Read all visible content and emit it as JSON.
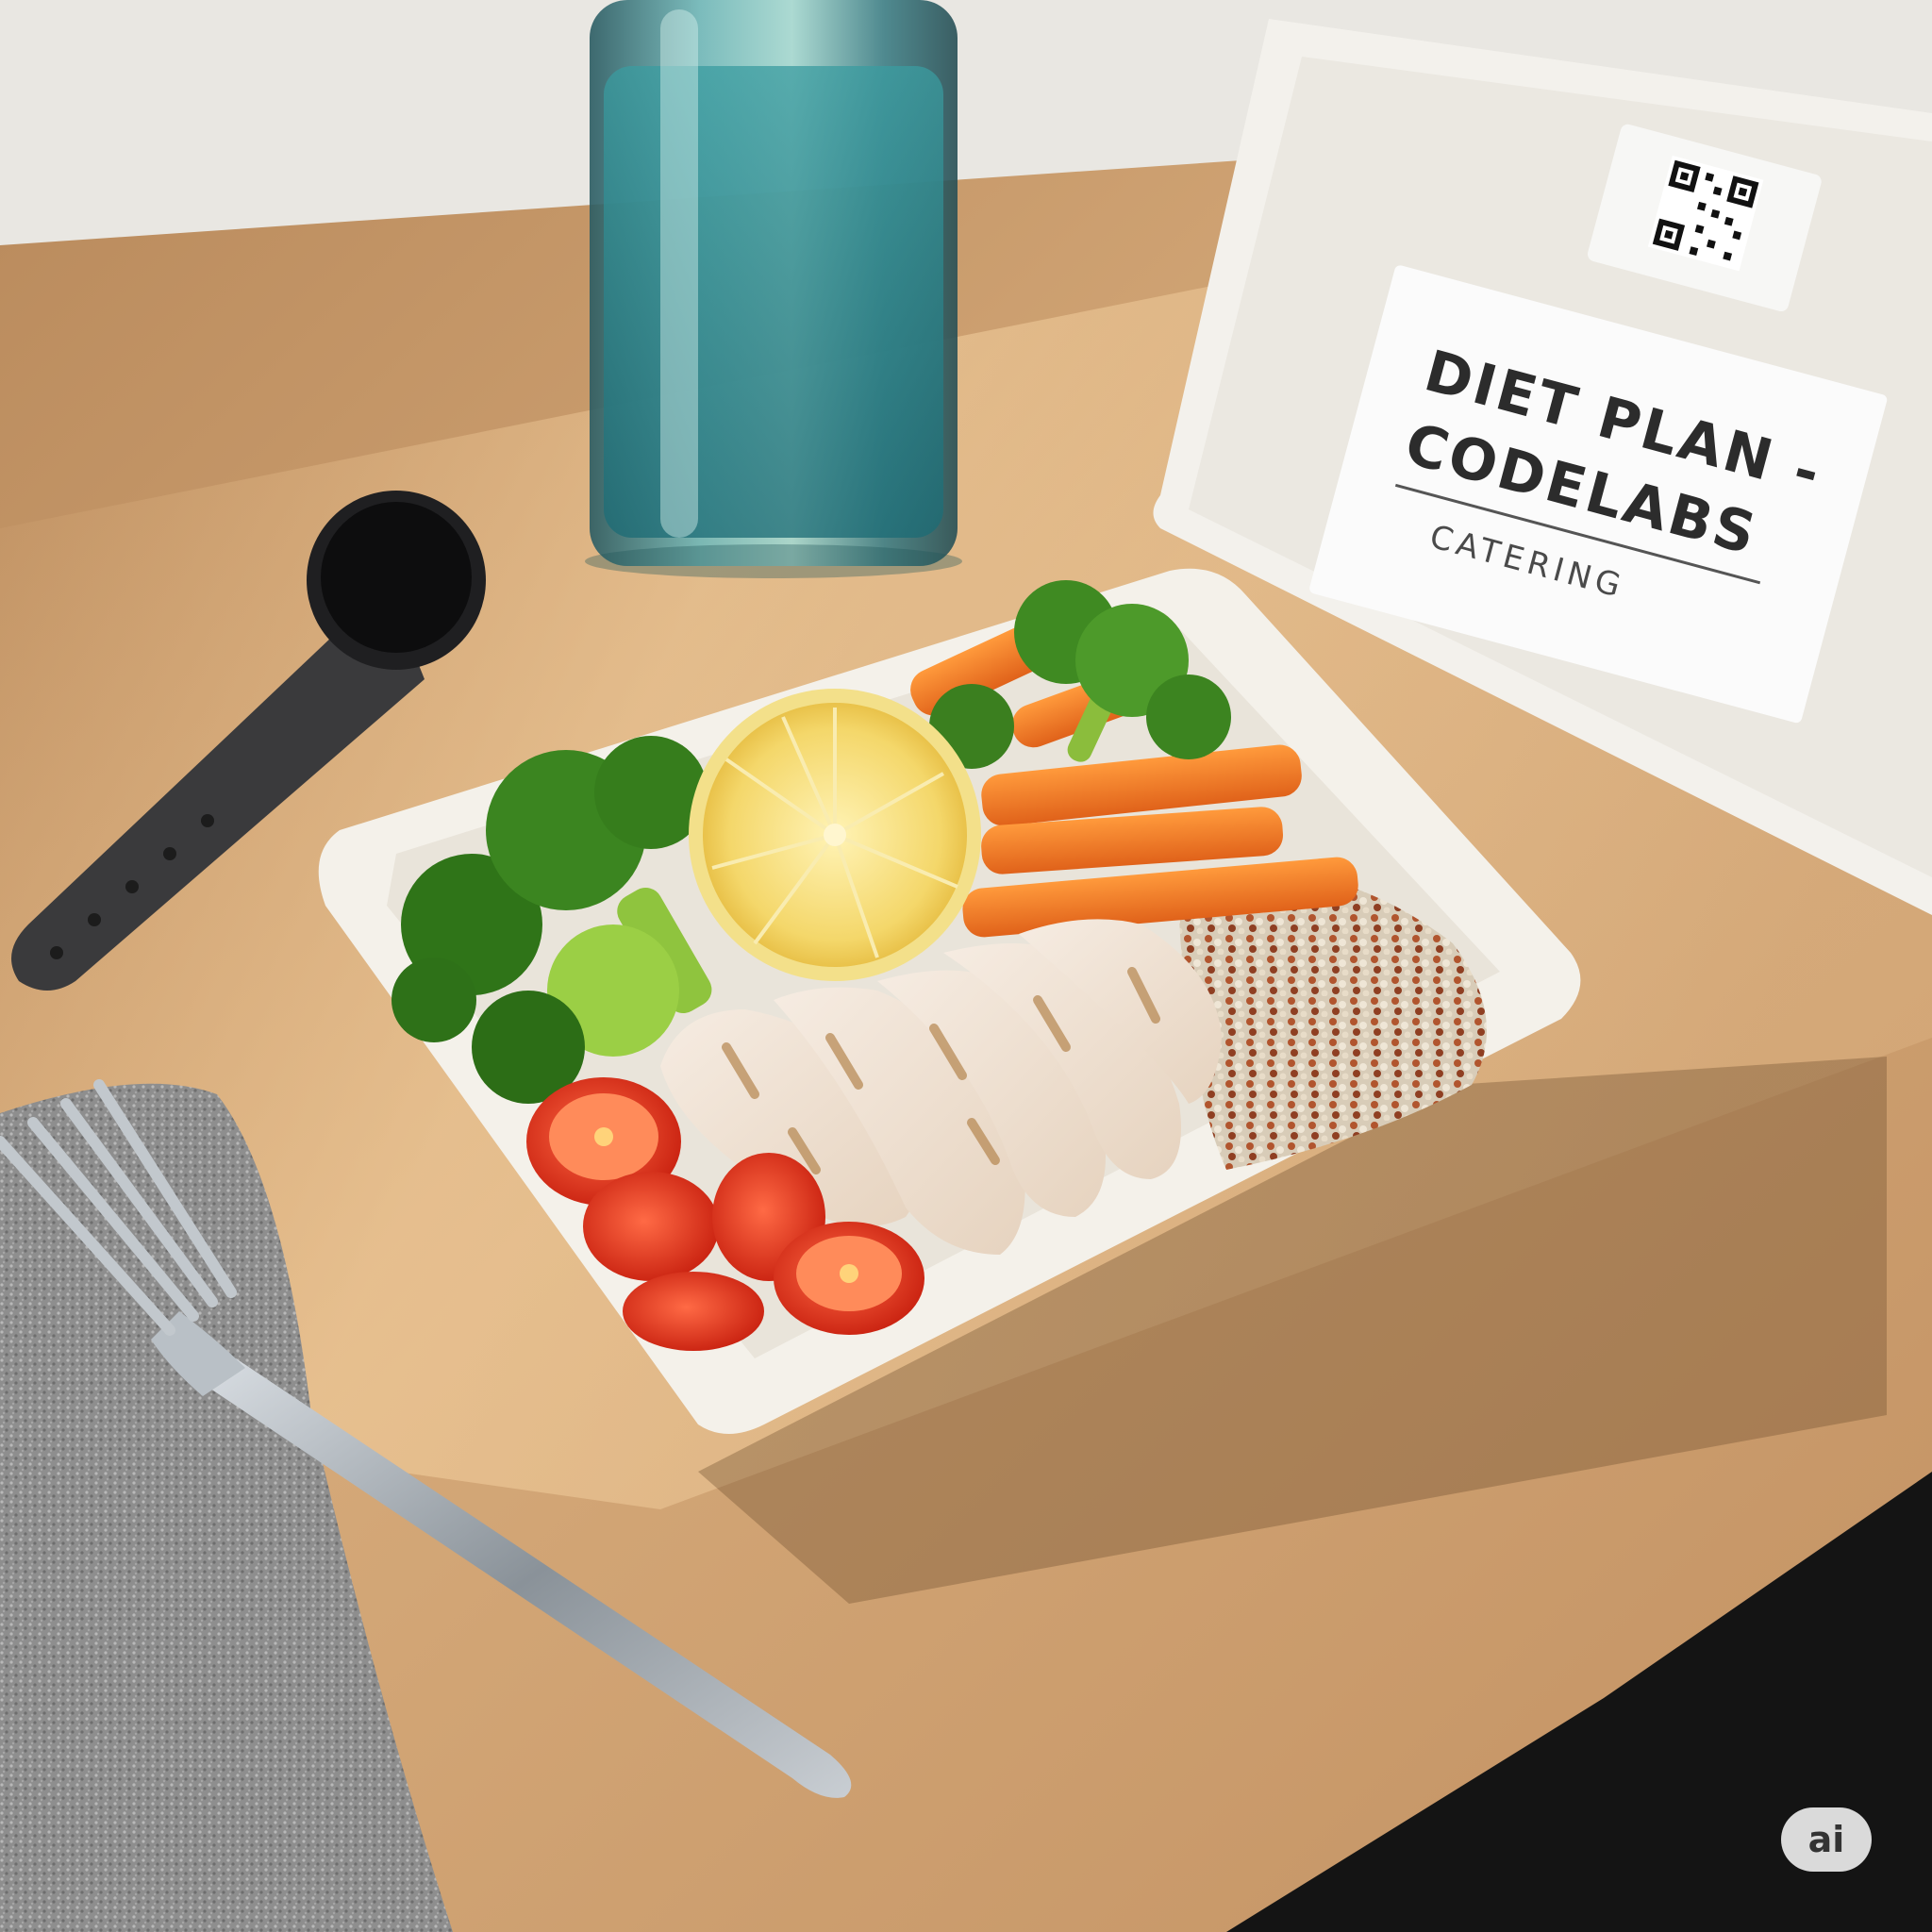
{
  "container_label": {
    "line1": "DIET PLAN -",
    "line2": "CODELABS",
    "line3": "CATERING"
  },
  "watermark": {
    "text": "ai"
  }
}
